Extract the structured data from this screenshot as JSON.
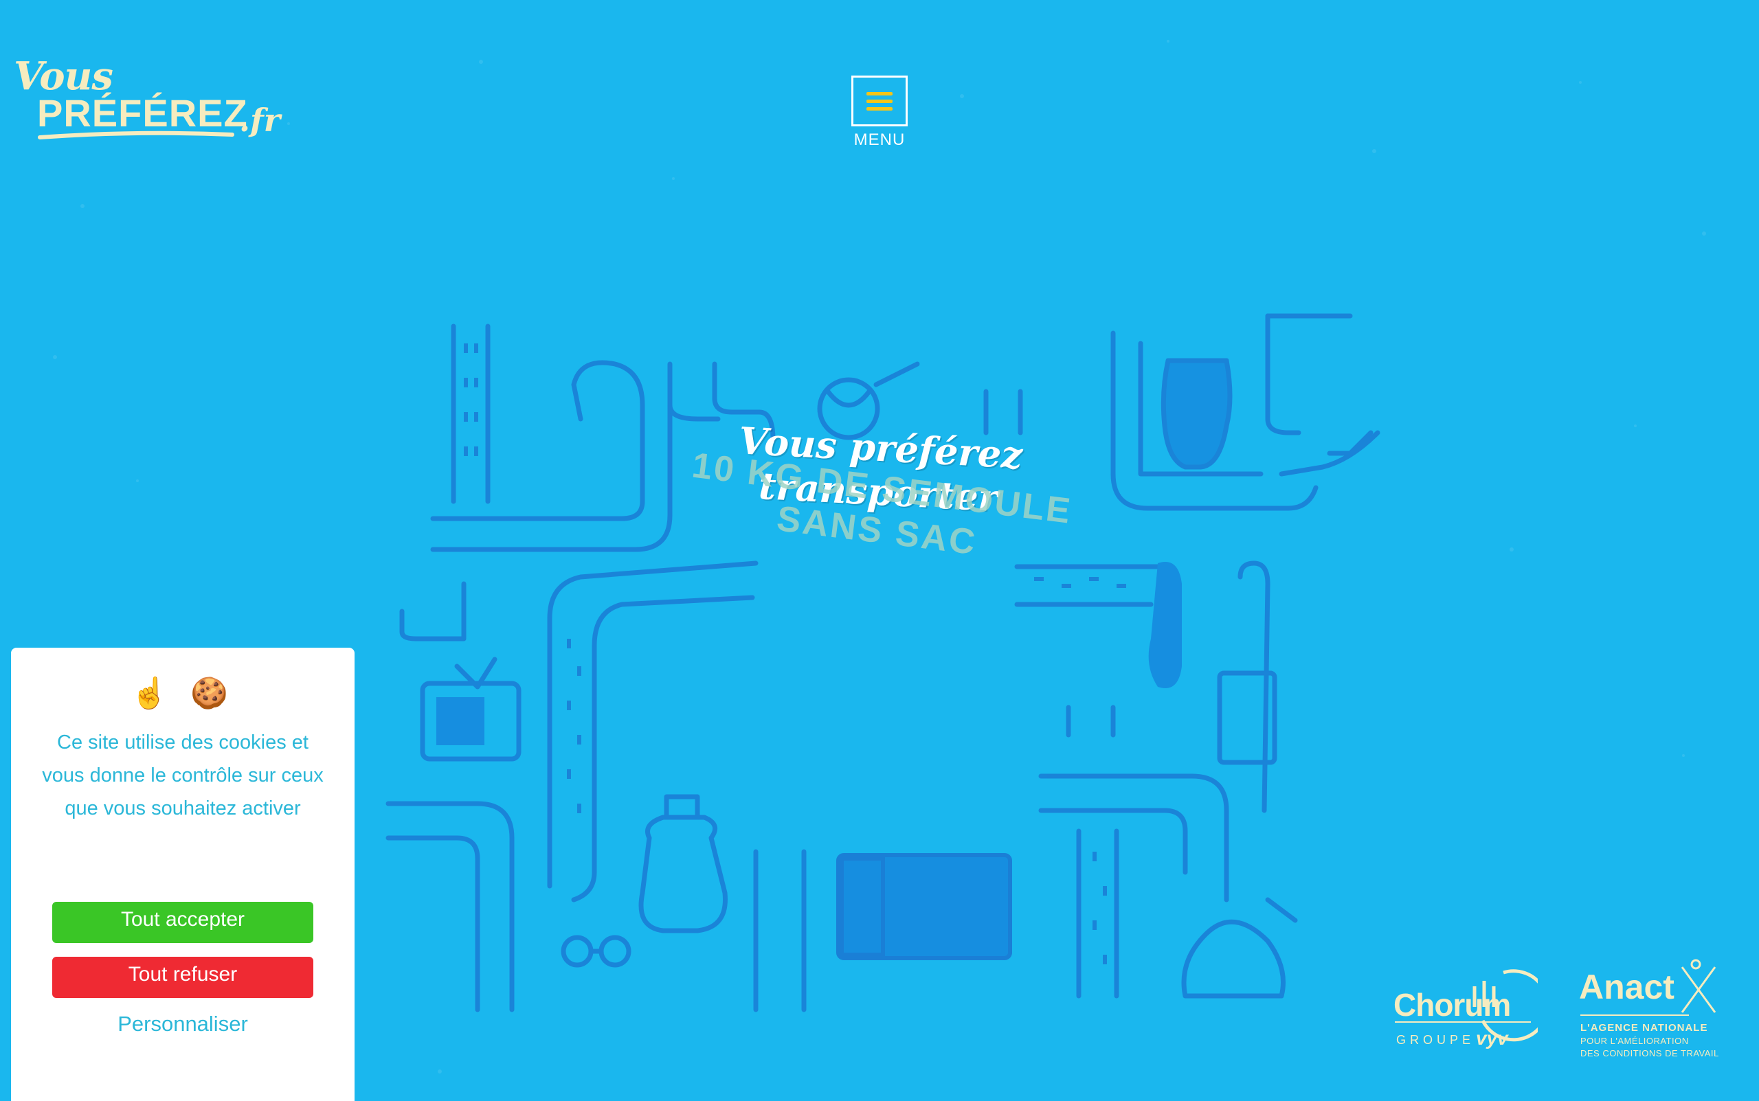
{
  "logo": {
    "line1": "Vous",
    "line2": "PRÉFÉREZ",
    "suffix": ".fr"
  },
  "menu": {
    "label": "MENU"
  },
  "hero": {
    "headline": "Vous préférez transporter",
    "subline1": "10 KG DE SEMOULE",
    "subline2": "SANS SAC"
  },
  "cookie_banner": {
    "emojis": "☝️ 🍪",
    "message": "Ce site utilise des cookies et vous donne le contrôle sur ceux que vous souhaitez activer",
    "accept_label": "Tout accepter",
    "refuse_label": "Tout refuser",
    "customize_label": "Personnaliser"
  },
  "partners": {
    "chorum": {
      "name": "Chorum",
      "groupe": "GROUPE",
      "vyv": "vyv"
    },
    "anact": {
      "name": "Anact",
      "line1": "L'AGENCE NATIONALE",
      "line2": "POUR L'AMÉLIORATION",
      "line3": "DES CONDITIONS DE TRAVAIL"
    }
  },
  "colors": {
    "background": "#1ab7ee",
    "logo_cream": "#f6ecbf",
    "menu_accent": "#f5c518",
    "accept": "#3ac626",
    "refuse": "#ef2a33",
    "cookie_text": "#2bb7d8"
  }
}
